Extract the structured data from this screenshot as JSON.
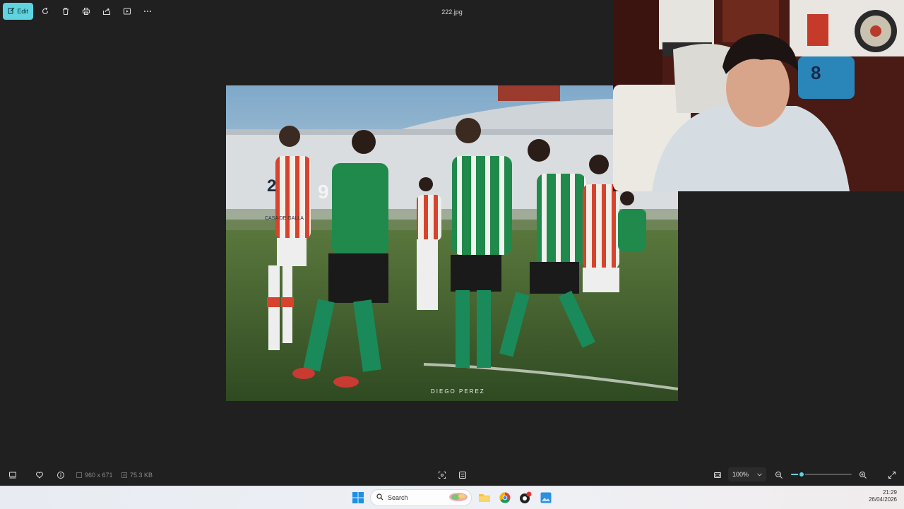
{
  "toolbar": {
    "edit_label": "Edit",
    "file_title": "222.jpg",
    "icons": [
      "edit-icon",
      "rotate-icon",
      "delete-icon",
      "print-icon",
      "share-icon",
      "slideshow-icon",
      "more-icon"
    ]
  },
  "photo": {
    "watermark": "DIEGO PEREZ",
    "player_numbers": [
      "2",
      "9"
    ],
    "sponsor_text": "CASA DE GALLA"
  },
  "webcam": {
    "jersey_number": "8"
  },
  "statusbar": {
    "dimensions": "960 x 671",
    "file_size": "75.3 KB",
    "zoom_level": "100%",
    "zoom_fraction": 0.17
  },
  "taskbar": {
    "search_placeholder": "Search",
    "time": "21:29",
    "date": "26/04/2026"
  },
  "colors": {
    "accent": "#5fd4e0",
    "background": "#202020",
    "team_green": "#1f8a4c",
    "team_red": "#d8432e"
  }
}
